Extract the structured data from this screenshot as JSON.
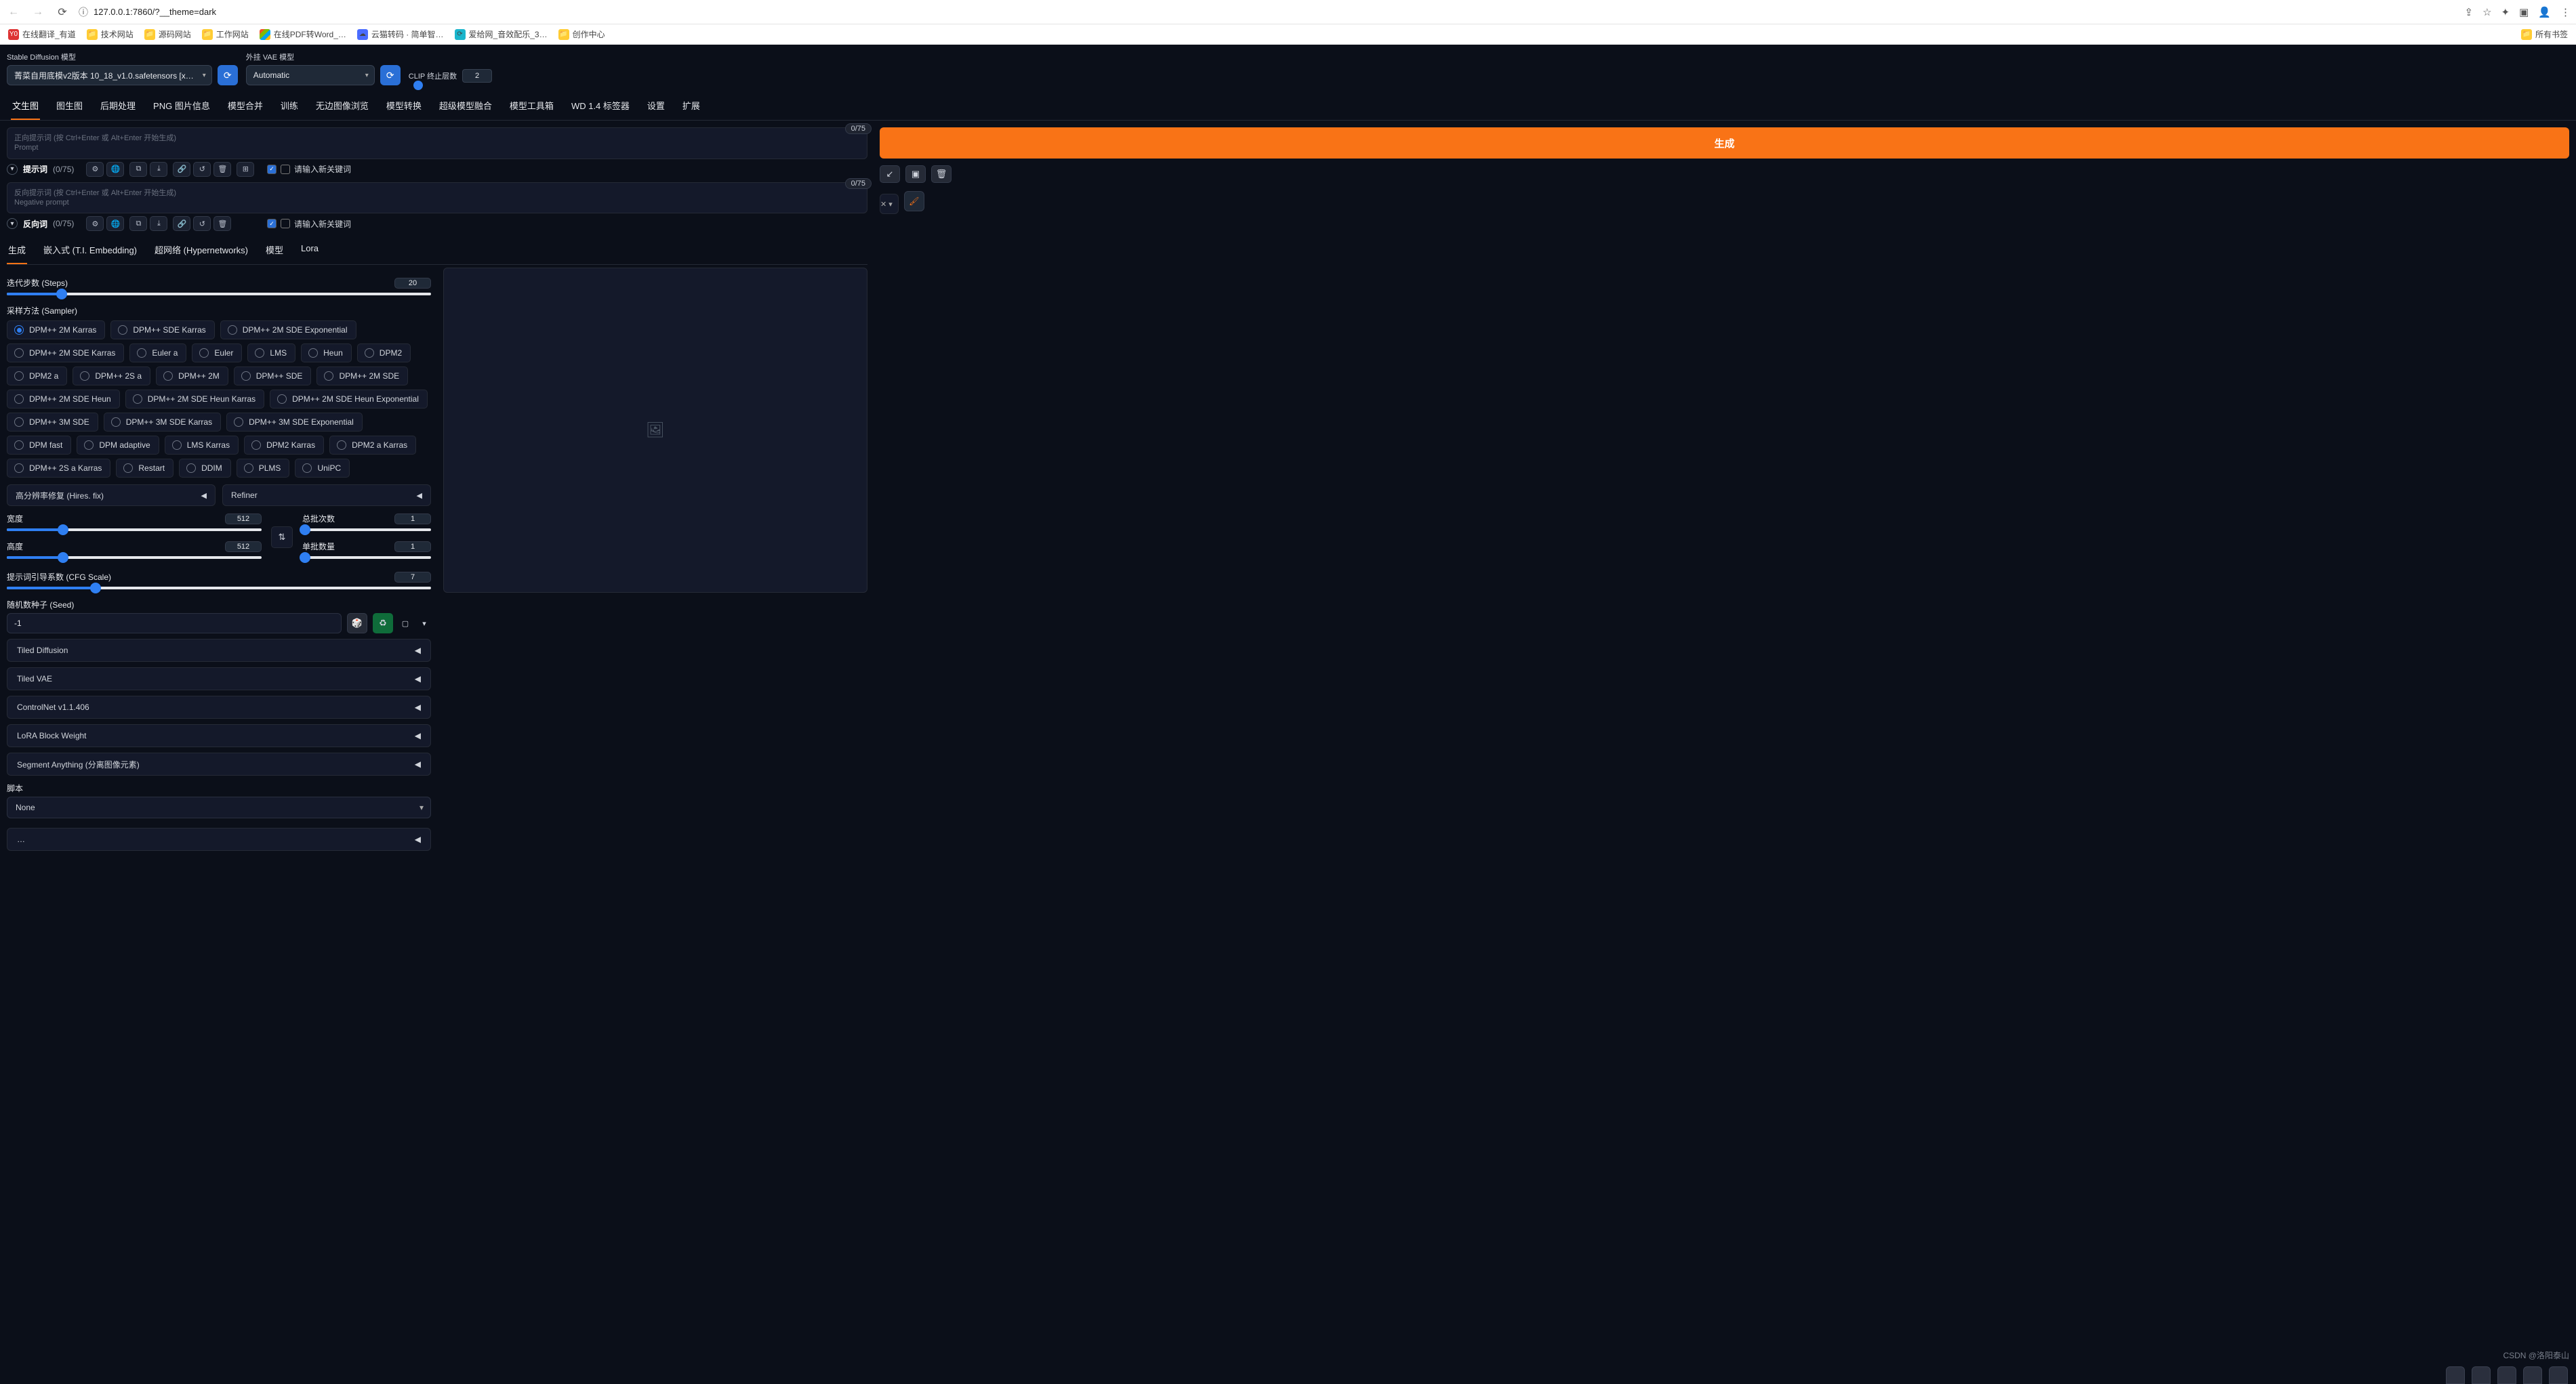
{
  "browser": {
    "url": "127.0.0.1:7860/?__theme=dark",
    "bookmarks": [
      "在线翻译_有道",
      "技术网站",
      "源码网站",
      "工作网站",
      "在线PDF转Word_…",
      "云猫转码 · 简单智…",
      "爱给网_音效配乐_3…",
      "创作中心"
    ],
    "allBookmarks": "所有书签"
  },
  "topSelects": {
    "sdLabel": "Stable Diffusion 模型",
    "sdValue": "菁菜自用底模v2版本 10_18_v1.0.safetensors [x…",
    "vaeLabel": "外挂 VAE 模型",
    "vaeValue": "Automatic",
    "clipLabel": "CLIP 终止层数",
    "clipValue": "2"
  },
  "tabs": [
    "文生图",
    "图生图",
    "后期处理",
    "PNG 图片信息",
    "模型合并",
    "训练",
    "无边图像浏览",
    "模型转换",
    "超级模型融合",
    "模型工具箱",
    "WD 1.4 标签器",
    "设置",
    "扩展"
  ],
  "tokenBadge": "0/75",
  "prompt": {
    "placeholder1": "正向提示词 (按 Ctrl+Enter 或 Alt+Enter 开始生成)",
    "placeholder2": "Prompt",
    "negPlaceholder1": "反向提示词 (按 Ctrl+Enter 或 Alt+Enter 开始生成)",
    "negPlaceholder2": "Negative prompt",
    "barTitle": "提示词",
    "barCount": "(0/75)",
    "negBarTitle": "反向词",
    "keywordHint": "请输入新关键词"
  },
  "generate": "生成",
  "subtabs": [
    "生成",
    "嵌入式 (T.I. Embedding)",
    "超网络 (Hypernetworks)",
    "模型",
    "Lora"
  ],
  "sliders": {
    "stepsLabel": "迭代步数 (Steps)",
    "stepsVal": "20",
    "samplerHead": "采样方法 (Sampler)",
    "hires": "高分辨率修复 (Hires. fix)",
    "refiner": "Refiner",
    "widthLabel": "宽度",
    "widthVal": "512",
    "heightLabel": "高度",
    "heightVal": "512",
    "batchCountLabel": "总批次数",
    "batchCountVal": "1",
    "batchSizeLabel": "单批数量",
    "batchSizeVal": "1",
    "cfgLabel": "提示词引导系数 (CFG Scale)",
    "cfgVal": "7",
    "seedLabel": "随机数种子 (Seed)",
    "seedVal": "-1"
  },
  "samplers": [
    "DPM++ 2M Karras",
    "DPM++ SDE Karras",
    "DPM++ 2M SDE Exponential",
    "DPM++ 2M SDE Karras",
    "Euler a",
    "Euler",
    "LMS",
    "Heun",
    "DPM2",
    "DPM2 a",
    "DPM++ 2S a",
    "DPM++ 2M",
    "DPM++ SDE",
    "DPM++ 2M SDE",
    "DPM++ 2M SDE Heun",
    "DPM++ 2M SDE Heun Karras",
    "DPM++ 2M SDE Heun Exponential",
    "DPM++ 3M SDE",
    "DPM++ 3M SDE Karras",
    "DPM++ 3M SDE Exponential",
    "DPM fast",
    "DPM adaptive",
    "LMS Karras",
    "DPM2 Karras",
    "DPM2 a Karras",
    "DPM++ 2S a Karras",
    "Restart",
    "DDIM",
    "PLMS",
    "UniPC"
  ],
  "accordions": [
    "Tiled Diffusion",
    "Tiled VAE",
    "ControlNet v1.1.406",
    "LoRA Block Weight",
    "Segment Anything (分离图像元素)"
  ],
  "script": {
    "label": "脚本",
    "value": "None"
  },
  "watermark": "CSDN @洛阳泰山"
}
